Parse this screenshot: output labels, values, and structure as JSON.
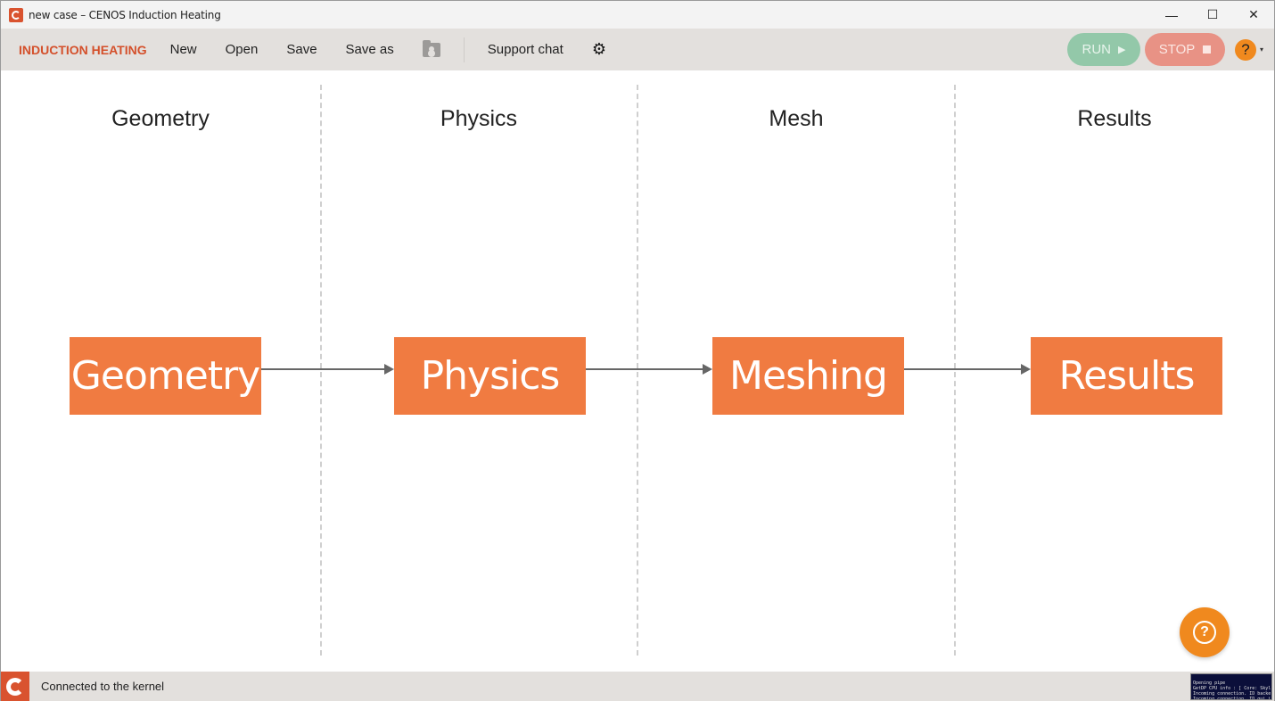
{
  "window": {
    "title": "new case – CENOS Induction Heating",
    "controls": {
      "minimize": "—",
      "maximize": "☐",
      "close": "✕"
    }
  },
  "toolbar": {
    "brand": "INDUCTION HEATING",
    "new_label": "New",
    "open_label": "Open",
    "save_label": "Save",
    "save_as_label": "Save as",
    "support_chat_label": "Support chat",
    "gear_glyph": "⚙",
    "run_label": "RUN",
    "run_glyph": "▶",
    "stop_label": "STOP",
    "help_glyph": "?",
    "help_caret": "▾"
  },
  "workflow": {
    "columns": [
      {
        "title": "Geometry",
        "step": "Geometry"
      },
      {
        "title": "Physics",
        "step": "Physics"
      },
      {
        "title": "Mesh",
        "step": "Meshing"
      },
      {
        "title": "Results",
        "step": "Results"
      }
    ]
  },
  "fab": {
    "glyph": "?"
  },
  "status": {
    "text": "Connected to the kernel",
    "console_lines": [
      "Opening pipe",
      "GetDP CPU info : [ Core: Skyl",
      "Incoming connection. ID backe",
      "Incoming connection. ID gui i"
    ]
  },
  "colors": {
    "accent": "#f07b41",
    "brand": "#d4502b",
    "run": "#93c8a9",
    "stop": "#e89285",
    "help": "#f0891e"
  }
}
